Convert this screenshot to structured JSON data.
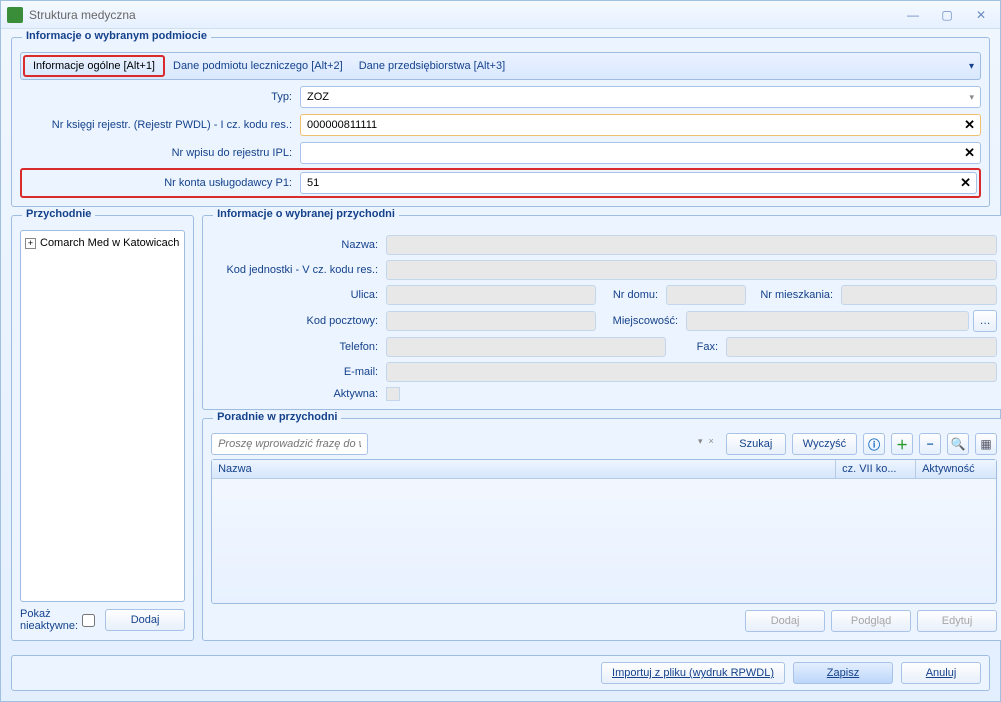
{
  "window": {
    "title": "Struktura medyczna"
  },
  "subject_info": {
    "title": "Informacje o wybranym podmiocie",
    "tabs": {
      "general": "Informacje ogólne [Alt+1]",
      "lecz": "Dane podmiotu leczniczego [Alt+2]",
      "przed": "Dane przedsiębiorstwa [Alt+3]"
    },
    "fields": {
      "typ_label": "Typ:",
      "typ_value": "ZOZ",
      "ksiega_label": "Nr księgi rejestr. (Rejestr PWDL) - I cz. kodu res.:",
      "ksiega_value": "000000811111",
      "wpis_label": "Nr wpisu do rejestru IPL:",
      "wpis_value": "",
      "konto_label": "Nr konta usługodawcy P1:",
      "konto_value": "51"
    }
  },
  "clinics": {
    "title": "Przychodnie",
    "tree_item": "Comarch Med w Katowicach",
    "show_inactive": "Pokaż nieaktywne:",
    "add": "Dodaj"
  },
  "clinic_info": {
    "title": "Informacje o wybranej przychodni",
    "labels": {
      "nazwa": "Nazwa:",
      "kod_jedn": "Kod jednostki - V cz. kodu res.:",
      "ulica": "Ulica:",
      "nr_domu": "Nr domu:",
      "nr_mieszk": "Nr mieszkania:",
      "kod_poczt": "Kod pocztowy:",
      "miejsc": "Miejscowość:",
      "telefon": "Telefon:",
      "fax": "Fax:",
      "email": "E-mail:",
      "aktywna": "Aktywna:"
    }
  },
  "clinic_depts": {
    "title": "Poradnie w przychodni",
    "search_placeholder": "Proszę wprowadzić frazę do wyszukania",
    "search_btn": "Szukaj",
    "clear_btn": "Wyczyść",
    "columns": {
      "nazwa": "Nazwa",
      "cz7": "cz. VII ko...",
      "aktywnosc": "Aktywność"
    },
    "dodaj": "Dodaj",
    "podglad": "Podgląd",
    "edytuj": "Edytuj"
  },
  "bottom": {
    "import": "Importuj z pliku (wydruk RPWDL)",
    "zapisz": "Zapisz",
    "anuluj": "Anuluj"
  }
}
